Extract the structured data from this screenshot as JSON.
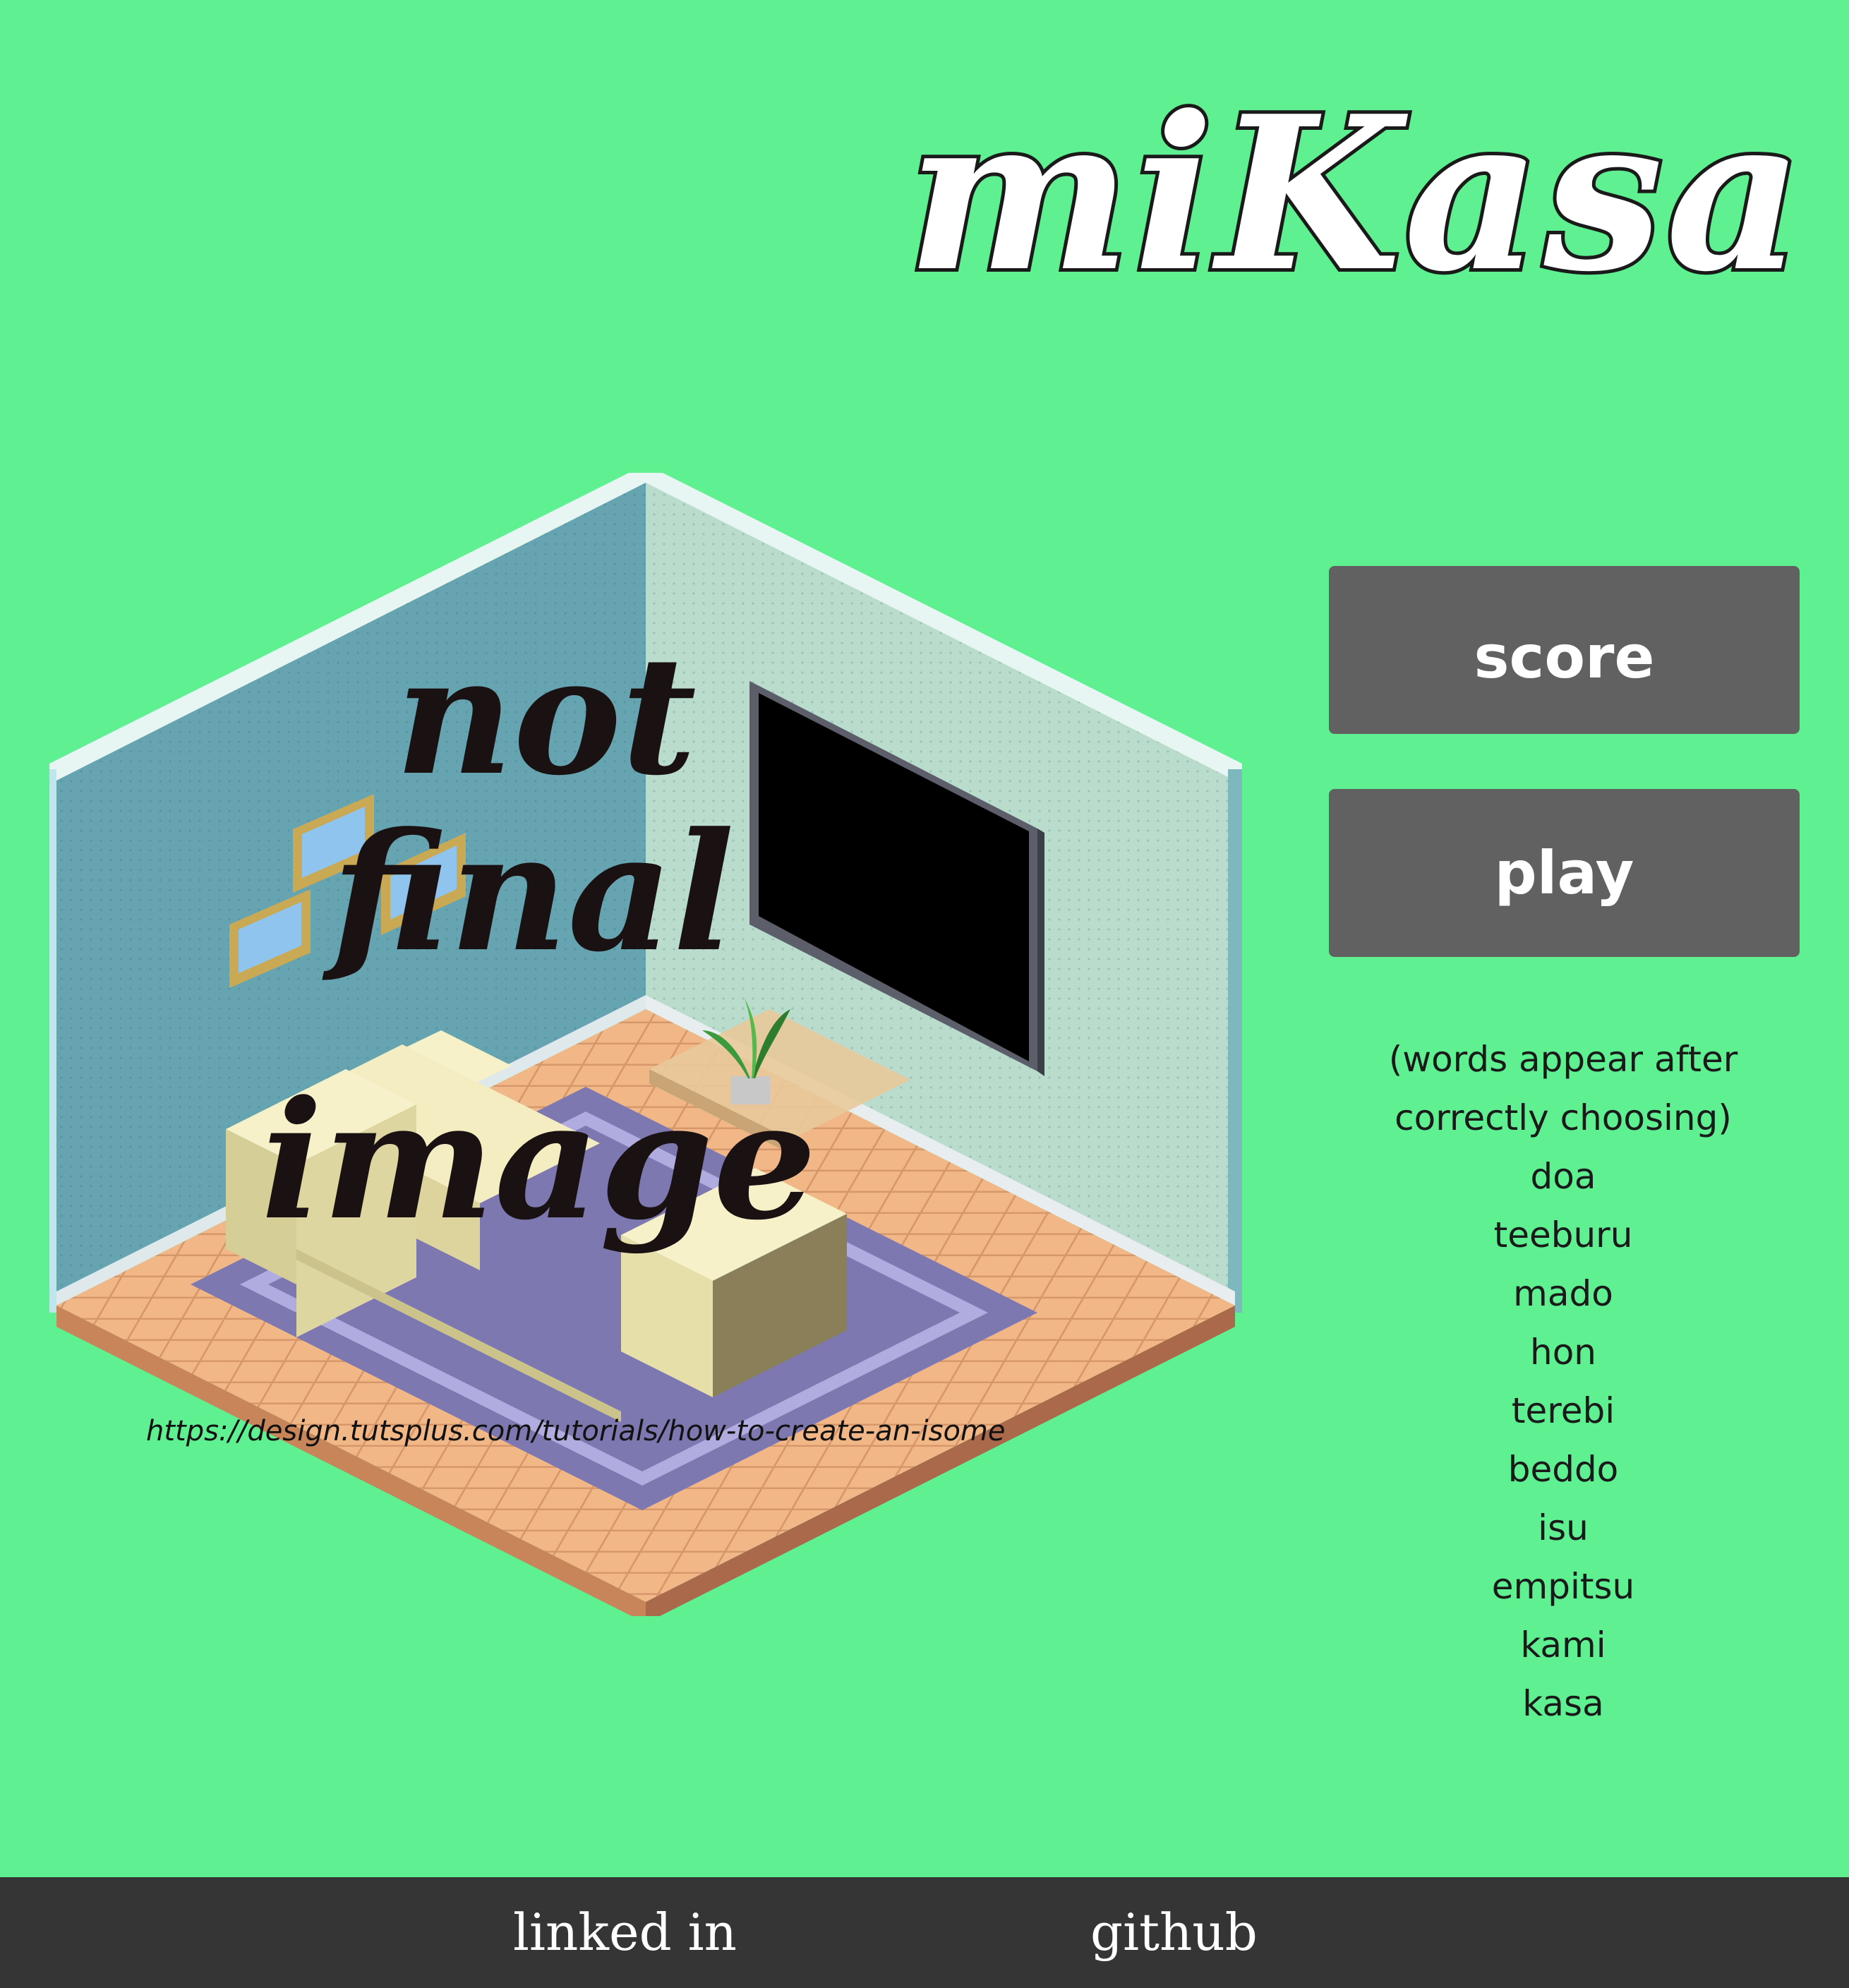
{
  "title": "miKasa",
  "buttons": {
    "score": "score",
    "play": "play"
  },
  "words_panel": {
    "note": "(words appear after correctly choosing)",
    "words": [
      "doa",
      "teeburu",
      "mado",
      "hon",
      "terebi",
      "beddo",
      "isu",
      "empitsu",
      "kami",
      "kasa"
    ]
  },
  "room_image": {
    "watermark": [
      "not",
      "final",
      "image"
    ],
    "credit": "https://design.tutsplus.com/tutorials/how-to-create-an-isome"
  },
  "footer": {
    "linkedin": "linked in",
    "github": "github"
  },
  "colors": {
    "background": "#5ff092",
    "button": "#616161",
    "footer": "#353535"
  }
}
